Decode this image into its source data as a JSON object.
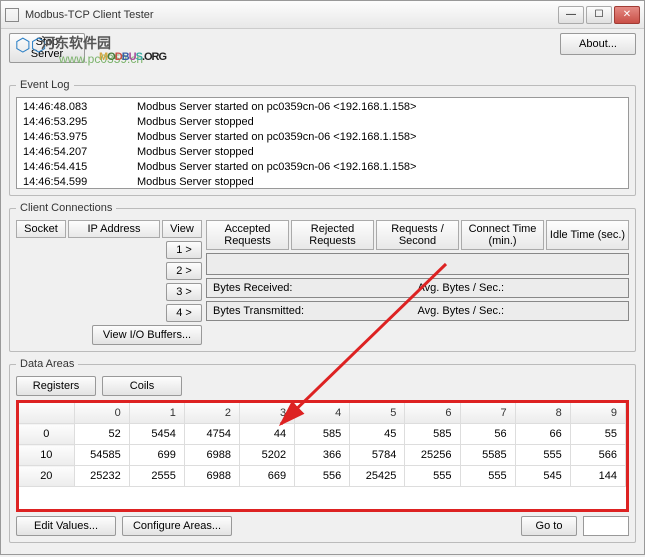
{
  "window": {
    "title": "Modbus-TCP Client Tester",
    "stop_server": "Stop Server",
    "about": "About...",
    "logo_text": "MODBUS.ORG",
    "overlay_site_cn": "河东软件园",
    "overlay_url": "www.pc0359.cn"
  },
  "event_log": {
    "legend": "Event Log",
    "rows": [
      {
        "ts": "14:46:48.083",
        "msg": "Modbus Server started on pc0359cn-06 <192.168.1.158>"
      },
      {
        "ts": "14:46:53.295",
        "msg": "Modbus Server stopped"
      },
      {
        "ts": "14:46:53.975",
        "msg": "Modbus Server started on pc0359cn-06 <192.168.1.158>"
      },
      {
        "ts": "14:46:54.207",
        "msg": "Modbus Server stopped"
      },
      {
        "ts": "14:46:54.415",
        "msg": "Modbus Server started on pc0359cn-06 <192.168.1.158>"
      },
      {
        "ts": "14:46:54.599",
        "msg": "Modbus Server stopped"
      }
    ]
  },
  "client_conn": {
    "legend": "Client Connections",
    "headers": {
      "socket": "Socket",
      "ip": "IP Address",
      "view": "View"
    },
    "view_buttons": [
      "1 >",
      "2 >",
      "3 >",
      "4 >"
    ],
    "view_io": "View I/O Buffers...",
    "stats_headers": [
      "Accepted Requests",
      "Rejected Requests",
      "Requests / Second",
      "Connect Time (min.)",
      "Idle Time (sec.)"
    ],
    "bytes_rx": "Bytes Received:",
    "avg_rx": "Avg. Bytes / Sec.:",
    "bytes_tx": "Bytes Transmitted:",
    "avg_tx": "Avg. Bytes / Sec.:"
  },
  "data_areas": {
    "legend": "Data Areas",
    "tabs": {
      "registers": "Registers",
      "coils": "Coils"
    },
    "cols": [
      "0",
      "1",
      "2",
      "3",
      "4",
      "5",
      "6",
      "7",
      "8",
      "9"
    ],
    "rows": [
      {
        "addr": "0",
        "vals": [
          "52",
          "5454",
          "4754",
          "44",
          "585",
          "45",
          "585",
          "56",
          "66",
          "55"
        ]
      },
      {
        "addr": "10",
        "vals": [
          "54585",
          "699",
          "6988",
          "5202",
          "366",
          "5784",
          "25256",
          "5585",
          "555",
          "566"
        ]
      },
      {
        "addr": "20",
        "vals": [
          "25232",
          "2555",
          "6988",
          "669",
          "556",
          "25425",
          "555",
          "555",
          "545",
          "144"
        ]
      }
    ],
    "edit_values": "Edit Values...",
    "configure_areas": "Configure Areas...",
    "goto": "Go to"
  }
}
